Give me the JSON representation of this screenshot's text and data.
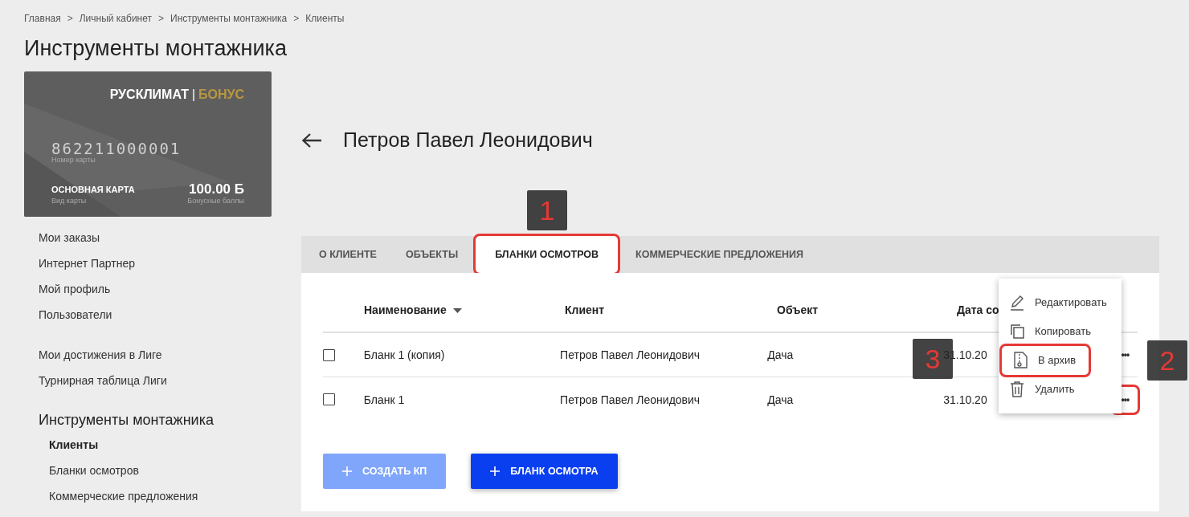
{
  "breadcrumbs": [
    "Главная",
    "Личный кабинет",
    "Инструменты монтажника",
    "Клиенты"
  ],
  "breadcrumb_separator": ">",
  "page_title": "Инструменты монтажника",
  "bonus_card": {
    "brand": "РУСКЛИМАТ",
    "brand_suffix": "БОНУС",
    "number": "862211000001",
    "number_label": "Номер карты",
    "card_type": "ОСНОВНАЯ КАРТА",
    "card_type_label": "Вид карты",
    "points": "100.00 Б",
    "points_label": "Бонусные баллы"
  },
  "sidebar": {
    "groups": [
      {
        "items": [
          {
            "label": "Мои заказы",
            "selected": false
          },
          {
            "label": "Интернет Партнер",
            "selected": false
          },
          {
            "label": "Мой профиль",
            "selected": false
          },
          {
            "label": "Пользователи",
            "selected": false
          }
        ]
      },
      {
        "items": [
          {
            "label": "Мои достижения в Лиге",
            "selected": false
          },
          {
            "label": "Турнирная таблица Лиги",
            "selected": false
          }
        ]
      },
      {
        "title": "Инструменты монтажника",
        "items": [
          {
            "label": "Клиенты",
            "selected": true
          },
          {
            "label": "Бланки осмотров",
            "selected": false
          },
          {
            "label": "Коммерческие предложения",
            "selected": false
          }
        ]
      }
    ]
  },
  "client_title": "Петров Павел Леонидович",
  "tabs": [
    {
      "label": "О КЛИЕНТЕ",
      "selected": false
    },
    {
      "label": "ОБЪЕКТЫ",
      "selected": false
    },
    {
      "label": "БЛАНКИ ОСМОТРОВ",
      "selected": true
    },
    {
      "label": "КОММЕРЧЕСКИЕ ПРЕДЛОЖЕНИЯ",
      "selected": false
    }
  ],
  "table": {
    "columns": [
      {
        "label": "Наименование",
        "sorted": true
      },
      {
        "label": "Клиент",
        "sorted": false
      },
      {
        "label": "Объект",
        "sorted": false
      },
      {
        "label": "Дата со",
        "sorted": false
      }
    ],
    "rows": [
      {
        "checked": false,
        "cells": [
          "Бланк 1 (копия)",
          "Петров Павел Леонидович",
          "Дача",
          "31.10.20"
        ]
      },
      {
        "checked": false,
        "cells": [
          "Бланк 1",
          "Петров Павел Леонидович",
          "Дача",
          "31.10.20"
        ]
      }
    ]
  },
  "more_button": "•••",
  "buttons": [
    {
      "label": "СОЗДАТЬ КП",
      "disabled": true
    },
    {
      "label": "БЛАНК ОСМОТРА",
      "disabled": false
    }
  ],
  "context_menu": [
    {
      "kind": "edit",
      "label": "Редактировать"
    },
    {
      "kind": "copy",
      "label": "Копировать"
    },
    {
      "kind": "archive",
      "label": "В архив"
    },
    {
      "kind": "delete",
      "label": "Удалить"
    }
  ],
  "callouts": [
    "1",
    "2",
    "3"
  ]
}
